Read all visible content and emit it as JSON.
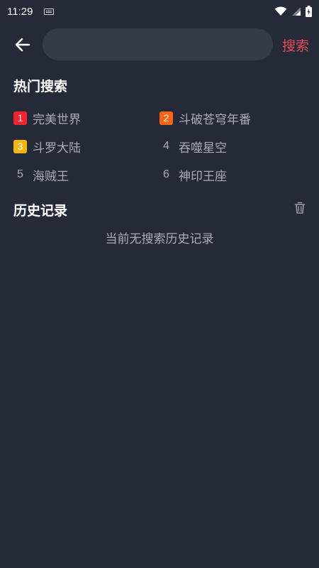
{
  "status_bar": {
    "time": "11:29"
  },
  "search": {
    "placeholder": "",
    "value": "",
    "button_label": "搜索"
  },
  "hot_search": {
    "title": "热门搜索",
    "items": [
      {
        "rank": "1",
        "label": "完美世界",
        "badge_color": "#f5222d"
      },
      {
        "rank": "2",
        "label": "斗破苍穹年番",
        "badge_color": "#fa6414"
      },
      {
        "rank": "3",
        "label": "斗罗大陆",
        "badge_color": "#f5b50a"
      },
      {
        "rank": "4",
        "label": "吞噬星空"
      },
      {
        "rank": "5",
        "label": "海贼王"
      },
      {
        "rank": "6",
        "label": "神印王座"
      }
    ]
  },
  "history": {
    "title": "历史记录",
    "empty_text": "当前无搜索历史记录"
  },
  "colors": {
    "background": "#252a38",
    "input_background": "#363b4a",
    "accent": "#e64957",
    "muted_text": "#a8acb8"
  },
  "icons": [
    "keyboard-icon",
    "wifi-icon",
    "signal-icon",
    "battery-icon",
    "back-arrow-icon",
    "trash-icon"
  ]
}
